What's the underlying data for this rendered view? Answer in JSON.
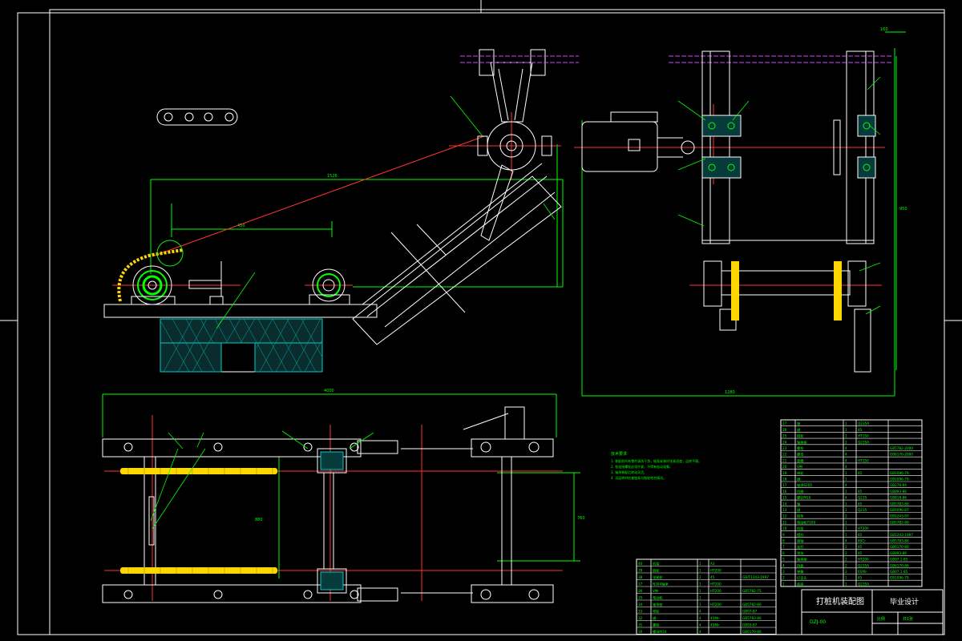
{
  "drawing": {
    "background": "#000000",
    "frame_color": "#ffffff",
    "object_color": "#ffffff",
    "center_line_color": "#ff0000",
    "dimension_color": "#00ff00",
    "chain_color": "#ffd700",
    "section_hatch_color": "#00ffff",
    "phantom_color": "#cc44ff",
    "accent_green": "#00ff00"
  },
  "dimensions": {
    "width_top_left": "1526",
    "sprocket_span": "450",
    "height_right": "950",
    "width_right_bottom": "1280",
    "top_right_small": "160",
    "width_bottom_total": "4000",
    "bottom_height_left": "880",
    "bottom_height_right": "760",
    "side_small": "600"
  },
  "technical_notes": {
    "heading": "技术要求",
    "lines": [
      "1. 装配前所有零件清洗干净，链条安装时张紧适度，运转平稳。",
      "2. 各连接螺栓必须拧紧，不得有松动现象。",
      "3. 轴承装配后转动灵活。",
      "4. 试运转时检查链条与链轮啮合情况。"
    ]
  },
  "parts_list": {
    "upper_rows": [
      [
        "27",
        "轴",
        "1",
        "Q235A",
        ""
      ],
      [
        "26",
        "键",
        "1",
        "45",
        ""
      ],
      [
        "25",
        "链轮",
        "1",
        "HT150",
        ""
      ],
      [
        "24",
        "轴承座",
        "2",
        "Q235A",
        ""
      ],
      [
        "23",
        "螺栓",
        "4",
        "",
        "GB5782-2000"
      ],
      [
        "22",
        "螺母",
        "4",
        "",
        "GB6170-2000"
      ],
      [
        "21",
        "垫圈",
        "4",
        "HT150",
        ""
      ],
      [
        "20",
        "V带",
        "4",
        "",
        ""
      ],
      [
        "19",
        "带轮",
        "1",
        "45",
        "GB1096-79"
      ],
      [
        "18",
        "键",
        "1",
        "",
        "GB1096-79"
      ],
      [
        "17",
        "轴承6205",
        "4",
        "",
        "GB276-94"
      ],
      [
        "16",
        "挡圈",
        "1",
        "45",
        "GB893-86"
      ],
      [
        "15",
        "螺钉M10",
        "4",
        "Q235",
        "GB818-86"
      ],
      [
        "14",
        "轴",
        "1",
        "45",
        "GB5783-86"
      ],
      [
        "13",
        "键",
        "1",
        "Q235",
        "GB1096-87"
      ],
      [
        "12",
        "链条",
        "2",
        "",
        "GB1243-97"
      ],
      [
        "11",
        "电动机Y100",
        "1",
        "",
        "GB5782-86"
      ],
      [
        "10",
        "机架",
        "1",
        "HT200",
        ""
      ],
      [
        "9",
        "摆杆",
        "1",
        "45",
        "GB1243-1997"
      ],
      [
        "8",
        "销轴",
        "4",
        "40Cr",
        "GB5783-86"
      ],
      [
        "7",
        "连杆",
        "2",
        "45",
        "GB6170-86"
      ],
      [
        "6",
        "滑块",
        "2",
        "45",
        "GB893-86"
      ],
      [
        "5",
        "轴承座",
        "2",
        "HT200",
        "GB97.1-85"
      ],
      [
        "4",
        "挡板",
        "2",
        "Q235A",
        "GB6170-86"
      ],
      [
        "3",
        "弹簧",
        "2",
        "65Mn",
        "GB97.1-85"
      ],
      [
        "2",
        "打击头",
        "1",
        "45",
        "GB1096-79"
      ],
      [
        "1",
        "底座",
        "1",
        "Q235A",
        ""
      ]
    ],
    "lower_rows": [
      [
        "40",
        "机架",
        "1",
        "A3",
        ""
      ],
      [
        "39",
        "链轮",
        "1",
        "HT200",
        ""
      ],
      [
        "38",
        "张紧轮",
        "2",
        "45",
        "GB/T1243-1997"
      ],
      [
        "37",
        "N304轴承",
        "1",
        "HT200",
        ""
      ],
      [
        "36",
        "V带",
        "1",
        "HT200",
        "GB5782-75"
      ],
      [
        "35",
        "电动机",
        "1",
        "",
        ""
      ],
      [
        "34",
        "轴承座",
        "1",
        "HT200",
        "GB5782-86"
      ],
      [
        "33",
        "带轮",
        "4",
        "",
        "GB97-87"
      ],
      [
        "32",
        "键",
        "4",
        "45Mn",
        "GB5783-86"
      ],
      [
        "31",
        "螺栓",
        "4",
        "45Mn",
        "GB93-87"
      ],
      [
        "30",
        "螺母M10",
        "4",
        "",
        "GB6170-86"
      ]
    ],
    "title": "打桩机装配图",
    "right_title": "毕业设计",
    "drawing_no": "DZJ-00",
    "scale_label": "比例",
    "sheet_label": "共1张"
  }
}
